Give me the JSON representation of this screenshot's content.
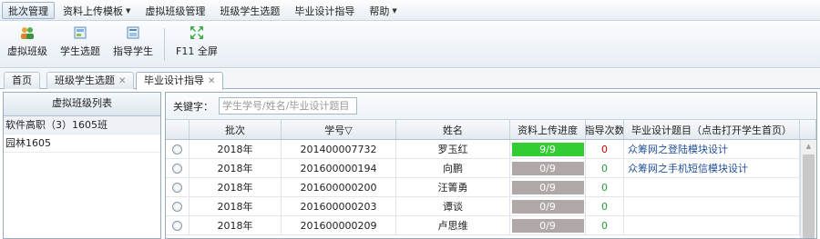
{
  "menu": [
    {
      "label": "批次管理",
      "active": true,
      "caret": false
    },
    {
      "label": "资料上传模板",
      "active": false,
      "caret": true
    },
    {
      "label": "虚拟班级管理",
      "active": false,
      "caret": false
    },
    {
      "label": "班级学生选题",
      "active": false,
      "caret": false
    },
    {
      "label": "毕业设计指导",
      "active": false,
      "caret": false
    },
    {
      "label": "帮助",
      "active": false,
      "caret": true
    }
  ],
  "menu_caret": "▼",
  "toolbar": [
    {
      "label": "虚拟班级",
      "icon": "group-users-icon"
    },
    {
      "label": "学生选题",
      "icon": "student-topic-icon"
    },
    {
      "label": "指导学生",
      "icon": "guide-student-icon"
    },
    {
      "label": "F11 全屏",
      "icon": "fullscreen-icon"
    }
  ],
  "tabs": [
    {
      "label": "首页",
      "closable": false,
      "active": false
    },
    {
      "label": "班级学生选题",
      "closable": true,
      "active": false
    },
    {
      "label": "毕业设计指导",
      "closable": true,
      "active": true
    }
  ],
  "close_glyph": "✕",
  "left_panel": {
    "title": "虚拟班级列表",
    "items": [
      "软件高职（3）1605班",
      "园林1605"
    ]
  },
  "search": {
    "label": "关键字：",
    "placeholder": "学生学号/姓名/毕业设计题目"
  },
  "grid": {
    "headers": [
      "批次",
      "学号▽",
      "姓名",
      "资料上传进度",
      "指导次数",
      "毕业设计题目（点击打开学生首页）"
    ],
    "rows": [
      {
        "batch": "2018年",
        "student_id": "201400007732",
        "name": "罗玉红",
        "progress": "9/9",
        "progress_fraction": 1.0,
        "count": "0",
        "topic": "众筹网之登陆模块设计"
      },
      {
        "batch": "2018年",
        "student_id": "201600000194",
        "name": "向鹏",
        "progress": "0/9",
        "progress_fraction": 0.0,
        "count": "0",
        "topic": "众筹网之手机短信模块设计"
      },
      {
        "batch": "2018年",
        "student_id": "201600000200",
        "name": "汪箐勇",
        "progress": "0/9",
        "progress_fraction": 0.0,
        "count": "0",
        "topic": ""
      },
      {
        "batch": "2018年",
        "student_id": "201600000203",
        "name": "谭谈",
        "progress": "0/9",
        "progress_fraction": 0.0,
        "count": "0",
        "topic": ""
      },
      {
        "batch": "2018年",
        "student_id": "201600000209",
        "name": "卢思维",
        "progress": "0/9",
        "progress_fraction": 0.0,
        "count": "0",
        "topic": ""
      }
    ]
  },
  "colors": {
    "progress_complete": "#33cc33",
    "progress_empty": "#b0a8a8",
    "count_first_row": "#d40000",
    "count_other_rows": "#2a9a3a",
    "topic_link": "#1f4f9a"
  }
}
